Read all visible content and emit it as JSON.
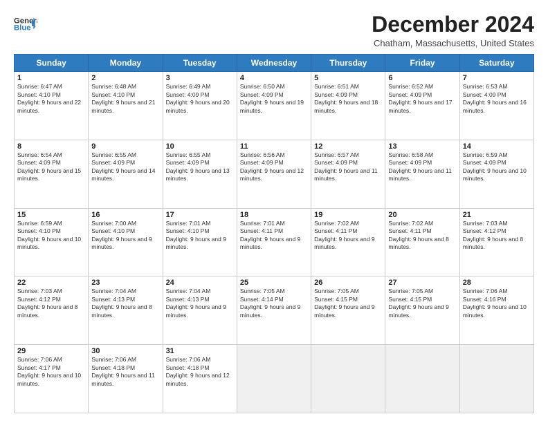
{
  "header": {
    "logo_line1": "General",
    "logo_line2": "Blue",
    "month": "December 2024",
    "location": "Chatham, Massachusetts, United States"
  },
  "weekdays": [
    "Sunday",
    "Monday",
    "Tuesday",
    "Wednesday",
    "Thursday",
    "Friday",
    "Saturday"
  ],
  "weeks": [
    [
      {
        "day": "1",
        "rise": "Sunrise: 6:47 AM",
        "set": "Sunset: 4:10 PM",
        "light": "Daylight: 9 hours and 22 minutes."
      },
      {
        "day": "2",
        "rise": "Sunrise: 6:48 AM",
        "set": "Sunset: 4:10 PM",
        "light": "Daylight: 9 hours and 21 minutes."
      },
      {
        "day": "3",
        "rise": "Sunrise: 6:49 AM",
        "set": "Sunset: 4:09 PM",
        "light": "Daylight: 9 hours and 20 minutes."
      },
      {
        "day": "4",
        "rise": "Sunrise: 6:50 AM",
        "set": "Sunset: 4:09 PM",
        "light": "Daylight: 9 hours and 19 minutes."
      },
      {
        "day": "5",
        "rise": "Sunrise: 6:51 AM",
        "set": "Sunset: 4:09 PM",
        "light": "Daylight: 9 hours and 18 minutes."
      },
      {
        "day": "6",
        "rise": "Sunrise: 6:52 AM",
        "set": "Sunset: 4:09 PM",
        "light": "Daylight: 9 hours and 17 minutes."
      },
      {
        "day": "7",
        "rise": "Sunrise: 6:53 AM",
        "set": "Sunset: 4:09 PM",
        "light": "Daylight: 9 hours and 16 minutes."
      }
    ],
    [
      {
        "day": "8",
        "rise": "Sunrise: 6:54 AM",
        "set": "Sunset: 4:09 PM",
        "light": "Daylight: 9 hours and 15 minutes."
      },
      {
        "day": "9",
        "rise": "Sunrise: 6:55 AM",
        "set": "Sunset: 4:09 PM",
        "light": "Daylight: 9 hours and 14 minutes."
      },
      {
        "day": "10",
        "rise": "Sunrise: 6:55 AM",
        "set": "Sunset: 4:09 PM",
        "light": "Daylight: 9 hours and 13 minutes."
      },
      {
        "day": "11",
        "rise": "Sunrise: 6:56 AM",
        "set": "Sunset: 4:09 PM",
        "light": "Daylight: 9 hours and 12 minutes."
      },
      {
        "day": "12",
        "rise": "Sunrise: 6:57 AM",
        "set": "Sunset: 4:09 PM",
        "light": "Daylight: 9 hours and 11 minutes."
      },
      {
        "day": "13",
        "rise": "Sunrise: 6:58 AM",
        "set": "Sunset: 4:09 PM",
        "light": "Daylight: 9 hours and 11 minutes."
      },
      {
        "day": "14",
        "rise": "Sunrise: 6:59 AM",
        "set": "Sunset: 4:09 PM",
        "light": "Daylight: 9 hours and 10 minutes."
      }
    ],
    [
      {
        "day": "15",
        "rise": "Sunrise: 6:59 AM",
        "set": "Sunset: 4:10 PM",
        "light": "Daylight: 9 hours and 10 minutes."
      },
      {
        "day": "16",
        "rise": "Sunrise: 7:00 AM",
        "set": "Sunset: 4:10 PM",
        "light": "Daylight: 9 hours and 9 minutes."
      },
      {
        "day": "17",
        "rise": "Sunrise: 7:01 AM",
        "set": "Sunset: 4:10 PM",
        "light": "Daylight: 9 hours and 9 minutes."
      },
      {
        "day": "18",
        "rise": "Sunrise: 7:01 AM",
        "set": "Sunset: 4:11 PM",
        "light": "Daylight: 9 hours and 9 minutes."
      },
      {
        "day": "19",
        "rise": "Sunrise: 7:02 AM",
        "set": "Sunset: 4:11 PM",
        "light": "Daylight: 9 hours and 9 minutes."
      },
      {
        "day": "20",
        "rise": "Sunrise: 7:02 AM",
        "set": "Sunset: 4:11 PM",
        "light": "Daylight: 9 hours and 8 minutes."
      },
      {
        "day": "21",
        "rise": "Sunrise: 7:03 AM",
        "set": "Sunset: 4:12 PM",
        "light": "Daylight: 9 hours and 8 minutes."
      }
    ],
    [
      {
        "day": "22",
        "rise": "Sunrise: 7:03 AM",
        "set": "Sunset: 4:12 PM",
        "light": "Daylight: 9 hours and 8 minutes."
      },
      {
        "day": "23",
        "rise": "Sunrise: 7:04 AM",
        "set": "Sunset: 4:13 PM",
        "light": "Daylight: 9 hours and 8 minutes."
      },
      {
        "day": "24",
        "rise": "Sunrise: 7:04 AM",
        "set": "Sunset: 4:13 PM",
        "light": "Daylight: 9 hours and 9 minutes."
      },
      {
        "day": "25",
        "rise": "Sunrise: 7:05 AM",
        "set": "Sunset: 4:14 PM",
        "light": "Daylight: 9 hours and 9 minutes."
      },
      {
        "day": "26",
        "rise": "Sunrise: 7:05 AM",
        "set": "Sunset: 4:15 PM",
        "light": "Daylight: 9 hours and 9 minutes."
      },
      {
        "day": "27",
        "rise": "Sunrise: 7:05 AM",
        "set": "Sunset: 4:15 PM",
        "light": "Daylight: 9 hours and 9 minutes."
      },
      {
        "day": "28",
        "rise": "Sunrise: 7:06 AM",
        "set": "Sunset: 4:16 PM",
        "light": "Daylight: 9 hours and 10 minutes."
      }
    ],
    [
      {
        "day": "29",
        "rise": "Sunrise: 7:06 AM",
        "set": "Sunset: 4:17 PM",
        "light": "Daylight: 9 hours and 10 minutes."
      },
      {
        "day": "30",
        "rise": "Sunrise: 7:06 AM",
        "set": "Sunset: 4:18 PM",
        "light": "Daylight: 9 hours and 11 minutes."
      },
      {
        "day": "31",
        "rise": "Sunrise: 7:06 AM",
        "set": "Sunset: 4:18 PM",
        "light": "Daylight: 9 hours and 12 minutes."
      },
      null,
      null,
      null,
      null
    ]
  ]
}
